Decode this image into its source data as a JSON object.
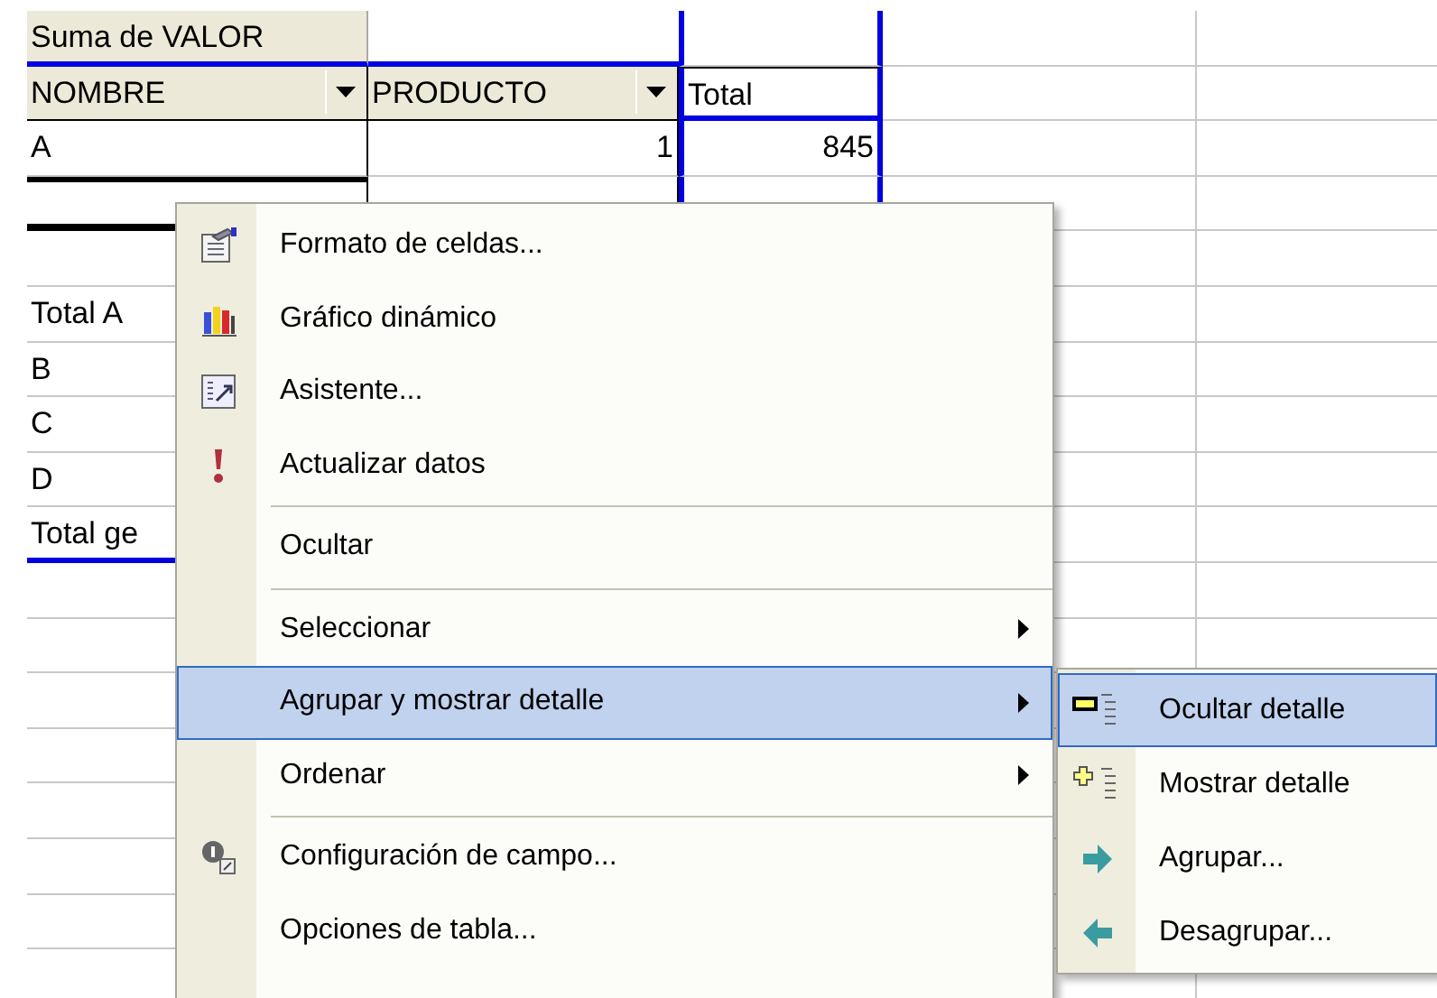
{
  "pivot": {
    "data_field": "Suma de VALOR",
    "row_fields": [
      {
        "label": "NOMBRE"
      },
      {
        "label": "PRODUCTO"
      }
    ],
    "column_header": "Total",
    "rows": [
      {
        "name": "A",
        "product": "1",
        "total": "845",
        "kind": "detail"
      },
      {
        "name": "",
        "product": "",
        "total": "",
        "kind": "hidden"
      },
      {
        "name": "",
        "product": "",
        "total": "",
        "kind": "gap"
      },
      {
        "name": "Total A",
        "product": "",
        "total": "",
        "kind": "subtotal"
      },
      {
        "name": "B",
        "product": "",
        "total": "",
        "kind": "detail"
      },
      {
        "name": "C",
        "product": "",
        "total": "",
        "kind": "detail"
      },
      {
        "name": "D",
        "product": "",
        "total": "",
        "kind": "detail"
      },
      {
        "name": "Total ge",
        "product": "",
        "total": "",
        "kind": "grand_total"
      }
    ]
  },
  "context_menu": {
    "items": [
      {
        "kind": "item",
        "label": "Formato de celdas...",
        "has_submenu": false,
        "selected": false
      },
      {
        "kind": "item",
        "label": "Gráfico dinámico",
        "has_submenu": false,
        "selected": false
      },
      {
        "kind": "item",
        "label": "Asistente...",
        "has_submenu": false,
        "selected": false
      },
      {
        "kind": "item",
        "label": "Actualizar datos",
        "has_submenu": false,
        "selected": false
      },
      {
        "kind": "separator"
      },
      {
        "kind": "item",
        "label": "Ocultar",
        "has_submenu": false,
        "selected": false
      },
      {
        "kind": "separator"
      },
      {
        "kind": "item",
        "label": "Seleccionar",
        "has_submenu": true,
        "selected": false
      },
      {
        "kind": "item",
        "label": "Agrupar y mostrar detalle",
        "has_submenu": true,
        "selected": true
      },
      {
        "kind": "item",
        "label": "Ordenar",
        "has_submenu": true,
        "selected": false
      },
      {
        "kind": "separator"
      },
      {
        "kind": "item",
        "label": "Configuración de campo...",
        "has_submenu": false,
        "selected": false
      },
      {
        "kind": "item",
        "label": "Opciones de tabla...",
        "has_submenu": false,
        "selected": false
      }
    ]
  },
  "submenu": {
    "items": [
      {
        "label": "Ocultar detalle",
        "selected": true
      },
      {
        "label": "Mostrar detalle",
        "selected": false
      },
      {
        "label": "Agrupar...",
        "selected": false
      },
      {
        "label": "Desagrupar...",
        "selected": false
      }
    ]
  }
}
